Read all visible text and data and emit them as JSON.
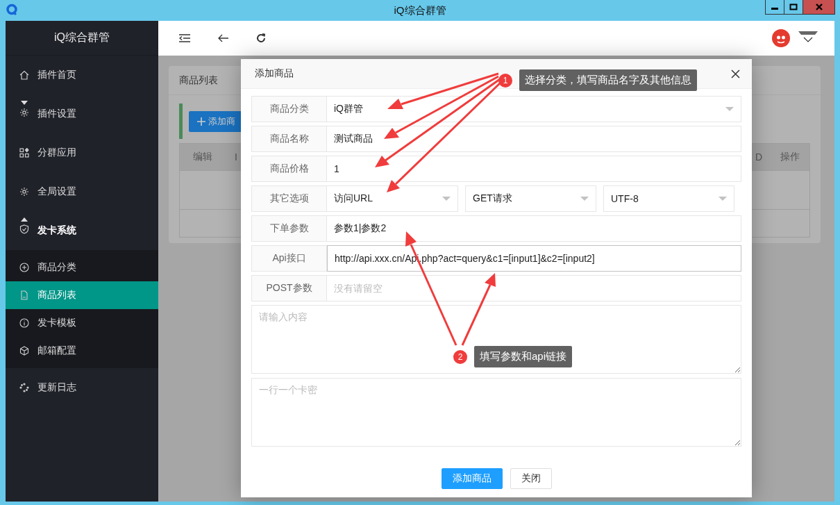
{
  "window": {
    "title": "iQ综合群管"
  },
  "sidebar": {
    "title": "iQ综合群管",
    "items": [
      {
        "label": "插件首页",
        "selected": false
      },
      {
        "label": "插件设置",
        "selected": false,
        "expanded": false
      },
      {
        "label": "分群应用",
        "selected": false
      },
      {
        "label": "全局设置",
        "selected": false
      },
      {
        "label": "发卡系统",
        "selected": false,
        "expanded": true,
        "children": [
          {
            "label": "商品分类",
            "selected": false
          },
          {
            "label": "商品列表",
            "selected": true
          },
          {
            "label": "发卡模板",
            "selected": false
          },
          {
            "label": "邮箱配置",
            "selected": false
          }
        ]
      },
      {
        "label": "更新日志",
        "selected": false
      }
    ]
  },
  "background_card": {
    "title": "商品列表",
    "add_button": "添加商",
    "columns_left": [
      "编辑",
      "I"
    ],
    "columns_right": [
      "D",
      "操作"
    ]
  },
  "dialog": {
    "title": "添加商品",
    "rows": [
      {
        "label": "商品分类",
        "kind": "select",
        "value": "iQ群管",
        "focused": false
      },
      {
        "label": "商品名称",
        "kind": "input",
        "value": "测试商品",
        "focused": false
      },
      {
        "label": "商品价格",
        "kind": "input",
        "value": "1",
        "focused": false
      },
      {
        "label": "其它选项",
        "kind": "selects",
        "options": [
          "访问URL",
          "GET请求",
          "UTF-8"
        ],
        "focused": false
      },
      {
        "label": "下单参数",
        "kind": "input",
        "value": "参数1|参数2",
        "focused": false
      },
      {
        "label": "Api接口",
        "kind": "input",
        "value": "http://api.xxx.cn/Api.php?act=query&c1=[input1]&c2=[input2]",
        "focused": true
      },
      {
        "label": "POST参数",
        "kind": "input",
        "placeholder": "没有请留空",
        "focused": false
      }
    ],
    "textareas": [
      {
        "placeholder": "请输入内容"
      },
      {
        "placeholder": "一行一个卡密"
      }
    ],
    "buttons": [
      {
        "label": "添加商品",
        "kind": "primary"
      },
      {
        "label": "关闭",
        "kind": "plain"
      }
    ]
  },
  "annotations": [
    {
      "number": "1",
      "text": "选择分类，填写商品名字及其他信息"
    },
    {
      "number": "2",
      "text": "填写参数和api链接"
    }
  ]
}
